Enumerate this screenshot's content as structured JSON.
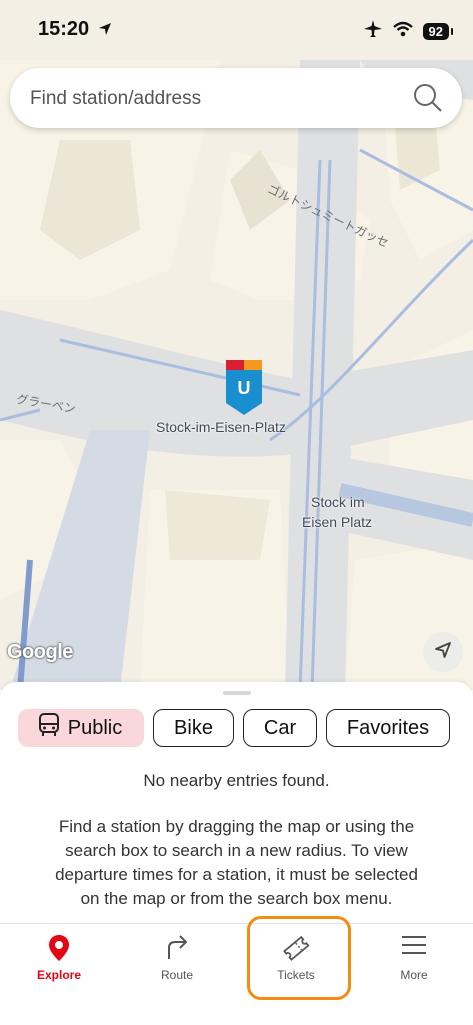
{
  "status_bar": {
    "time": "15:20",
    "battery": "92"
  },
  "search": {
    "placeholder": "Find station/address"
  },
  "map": {
    "labels": {
      "street_top": "ゴルトシュミートガッセ",
      "street_left": "グラーベン",
      "station_marker": "Stock-im-Eisen-Platz",
      "stop_line1": "Stock im",
      "stop_line2": "Eisen Platz"
    },
    "marker_letter": "U",
    "attribution": "Google"
  },
  "filters": [
    {
      "label": "Public",
      "active": true
    },
    {
      "label": "Bike",
      "active": false
    },
    {
      "label": "Car",
      "active": false
    },
    {
      "label": "Favorites",
      "active": false
    }
  ],
  "results": {
    "empty_title": "No nearby entries found.",
    "empty_body": "Find a station by dragging the map or using the search box to search in a new radius. To view departure times for a station, it must be selected on the map or from the search box menu."
  },
  "tabs": [
    {
      "label": "Explore",
      "icon": "map-pin-icon",
      "active": true
    },
    {
      "label": "Route",
      "icon": "route-arrow-icon",
      "active": false
    },
    {
      "label": "Tickets",
      "icon": "ticket-icon",
      "active": false
    },
    {
      "label": "More",
      "icon": "hamburger-icon",
      "active": false
    }
  ],
  "colors": {
    "accent": "#e30613",
    "chip_active_bg": "#f9d7da",
    "highlight": "#f28c13",
    "marker_blue": "#1a8fd0"
  }
}
